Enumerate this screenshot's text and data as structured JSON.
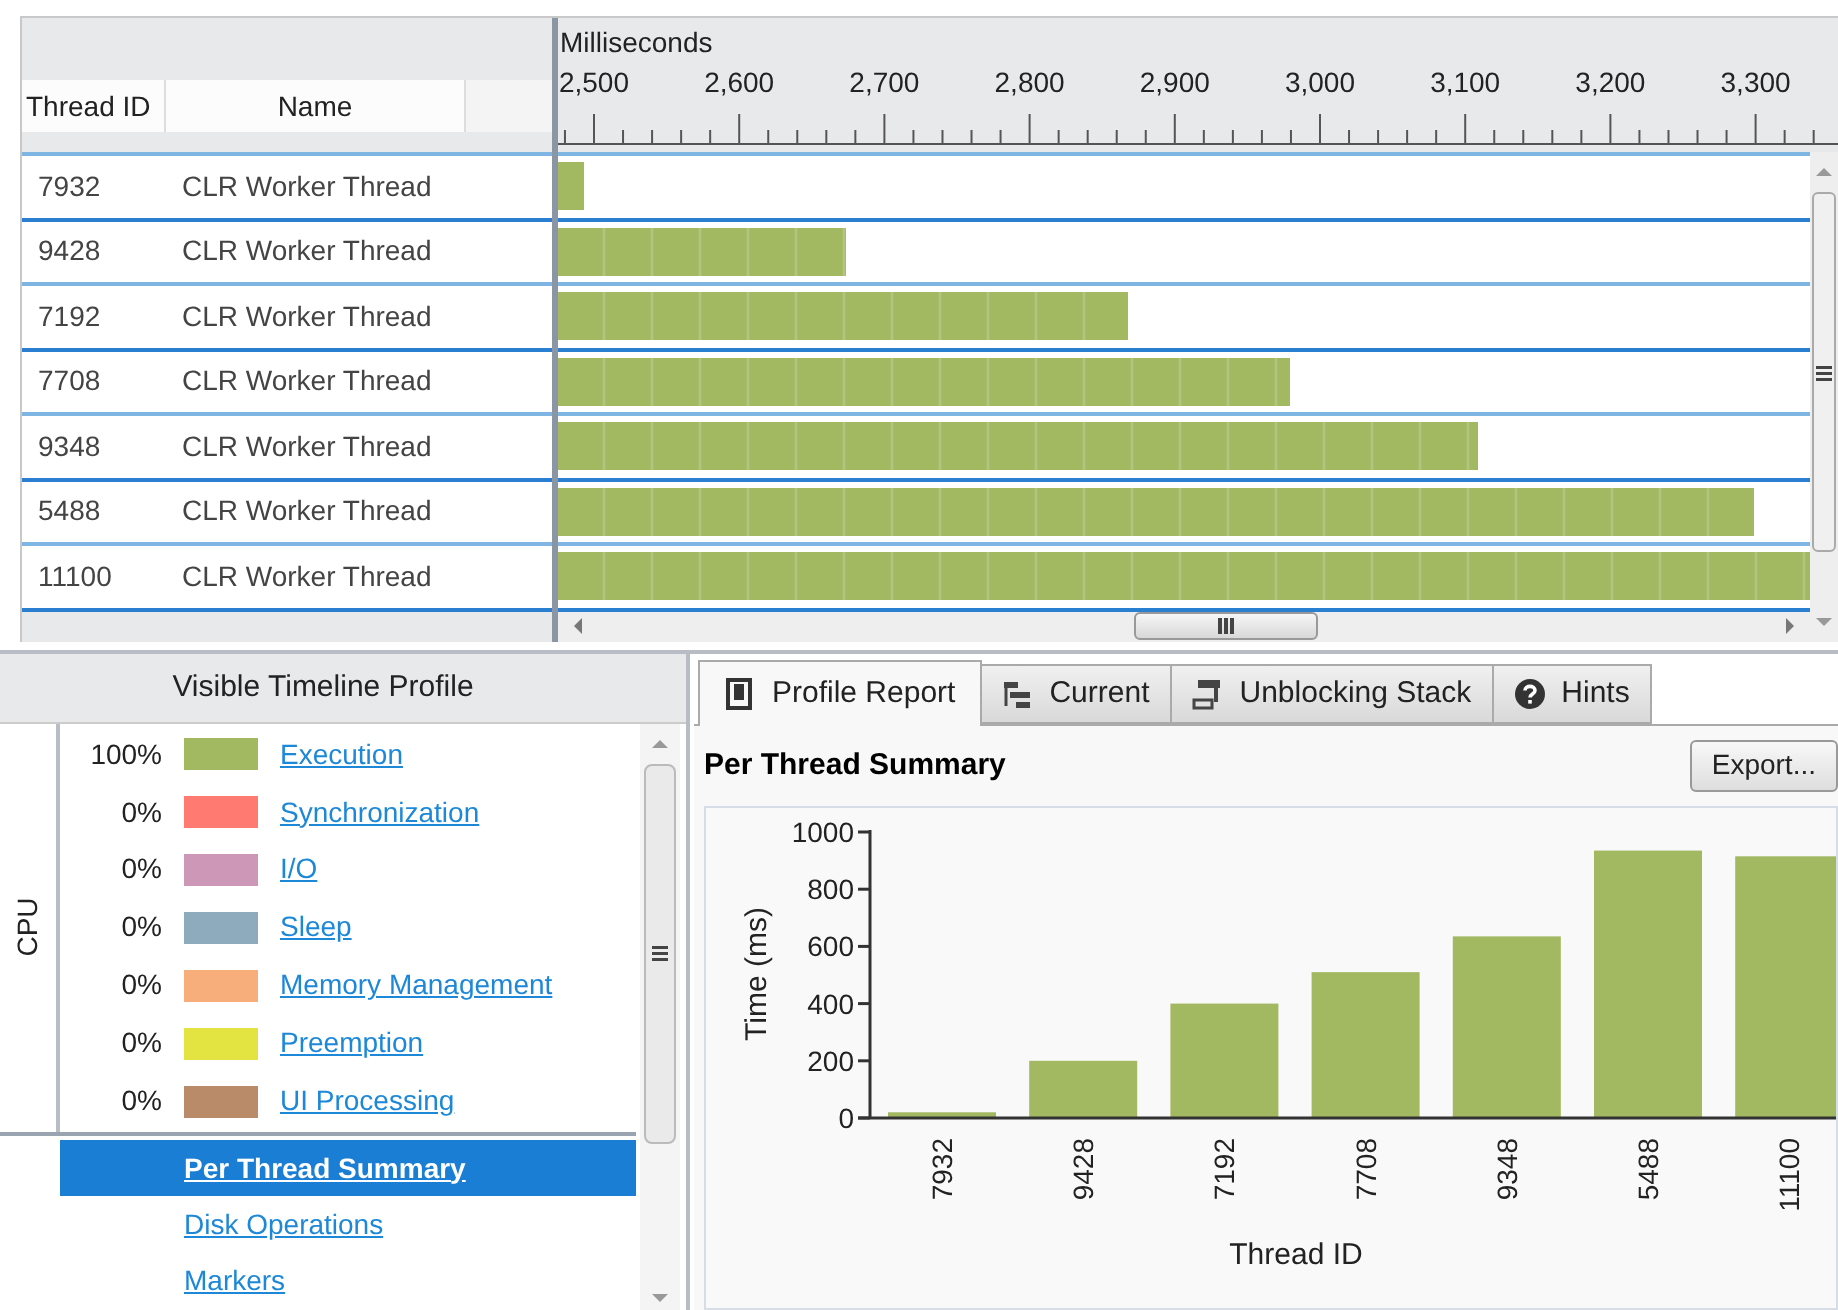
{
  "threads": {
    "columns": [
      "Thread ID",
      "Name"
    ],
    "rows": [
      {
        "id": "7932",
        "name": "CLR Worker Thread",
        "level": 0.02
      },
      {
        "id": "9428",
        "name": "CLR Worker Thread",
        "level": 0.23
      },
      {
        "id": "7192",
        "name": "CLR Worker Thread",
        "level": 0.455
      },
      {
        "id": "7708",
        "name": "CLR Worker Thread",
        "level": 0.585
      },
      {
        "id": "9348",
        "name": "CLR Worker Thread",
        "level": 0.735
      },
      {
        "id": "5488",
        "name": "CLR Worker Thread",
        "level": 0.955
      },
      {
        "id": "11100",
        "name": "CLR Worker Thread",
        "level": 1
      }
    ]
  },
  "timeline": {
    "axis_title": "Milliseconds",
    "ticks": [
      "2,500",
      "2,600",
      "2,700",
      "2,800",
      "2,900",
      "3,000",
      "3,100",
      "3,200",
      "3,300"
    ]
  },
  "profile": {
    "title": "Visible Timeline Profile",
    "group": "CPU",
    "categories": [
      {
        "percent": "100%",
        "label": "Execution",
        "color": "#a2b861"
      },
      {
        "percent": "0%",
        "label": "Synchronization",
        "color": "#ff7b71"
      },
      {
        "percent": "0%",
        "label": "I/O",
        "color": "#cd97b7"
      },
      {
        "percent": "0%",
        "label": "Sleep",
        "color": "#8eaabd"
      },
      {
        "percent": "0%",
        "label": "Memory Management",
        "color": "#f8ae7a"
      },
      {
        "percent": "0%",
        "label": "Preemption",
        "color": "#e3e341"
      },
      {
        "percent": "0%",
        "label": "UI Processing",
        "color": "#b98b68"
      }
    ],
    "reports": [
      {
        "label": "Per Thread Summary",
        "selected": true
      },
      {
        "label": "Disk Operations",
        "selected": false
      },
      {
        "label": "Markers",
        "selected": false
      }
    ]
  },
  "tabs": [
    {
      "label": "Profile Report",
      "kind": "report",
      "selected": true
    },
    {
      "label": "Current",
      "kind": "current",
      "selected": false
    },
    {
      "label": "Unblocking Stack",
      "kind": "stack",
      "selected": false
    },
    {
      "label": "Hints",
      "kind": "hint",
      "selected": false
    }
  ],
  "report": {
    "title": "Per Thread Summary",
    "export_button": "Export...",
    "chart_data": {
      "type": "bar",
      "xlabel": "Thread ID",
      "ylabel": "Time (ms)",
      "categories": [
        "7932",
        "9428",
        "7192",
        "7708",
        "9348",
        "5488",
        "11100"
      ],
      "series": [
        {
          "color": "#a2b861",
          "values": [
            20,
            200,
            400,
            510,
            635,
            935,
            915
          ]
        }
      ],
      "ylim": [
        0,
        1000
      ],
      "yticks": [
        0,
        200,
        400,
        600,
        800,
        1000
      ]
    }
  }
}
